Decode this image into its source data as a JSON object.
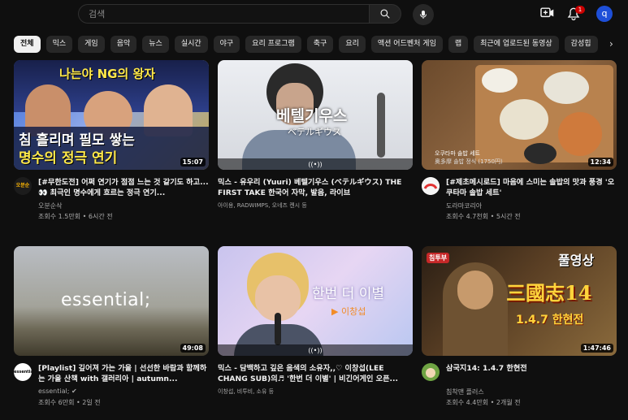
{
  "search": {
    "placeholder": "검색"
  },
  "header": {
    "notification_count": "1",
    "avatar_letter": "q"
  },
  "chips": [
    "전체",
    "믹스",
    "게임",
    "음악",
    "뉴스",
    "실시간",
    "야구",
    "요리 프로그램",
    "축구",
    "요리",
    "액션 어드벤처 게임",
    "랩",
    "최근에 업로드된 동영상",
    "감성힙"
  ],
  "videos": [
    {
      "title": "[#무한도전] 어쩌 연기가 점점 느는 것 같기도 하고...👀 최극인 명수에게 흐르는 정극 연기...",
      "channel": "오분순삭",
      "stats": "조회수 1.5만회 • 6시간 전",
      "duration": "15:07",
      "thumb_lines": [
        "나는야 NG의 왕자",
        "침 흘리며 필모 쌓는",
        "명수의 정극 연기"
      ],
      "channel_avatar_text": "오분순삭"
    },
    {
      "title": "믹스 - 유우리 (Yuuri) 베텔기우스 (ベテルギウス) THE FIRST TAKE 한국어 자막, 발음, 라이브",
      "channel": "아이용, RADWIMPS, 오네즈 켄시 등",
      "stats": "",
      "duration": "",
      "thumb_lines": [
        "베텔기우스",
        "ベテルギウス"
      ]
    },
    {
      "title": "[#제초메시로드] 마음에 스미는 솔밥의 맛과 풍경 '오쿠타마 솔밥 세트'",
      "channel": "도라마코리아",
      "stats": "조회수 4.7천회 • 5시간 전",
      "duration": "12:34",
      "thumb_lines": [
        "오쿠타마 솔밥 세트",
        "奥多摩 솔밥 정식 (1750円)"
      ]
    },
    {
      "title": "[Playlist] 깊어져 가는 가을 | 선선한 바람과 함께하는 가을 산책 with 갤러리아 | autumn...",
      "channel": "essential; ✔",
      "stats": "조회수 6만회 • 2일 전",
      "duration": "49:08",
      "thumb_lines": [
        "essential;"
      ]
    },
    {
      "title": "믹스 - 담백하고 깊은 음색의 소유자,,♡ 이창섭(LEE CHANG SUB)의♬ '한번 더 이별' | 비긴어게인 오픈...",
      "channel": "이창섭, 비투비, 소유 등",
      "stats": "",
      "duration": "",
      "thumb_lines": [
        "한번 더 이별",
        "▶ 이창섭"
      ]
    },
    {
      "title": "삼국지14: 1.4.7 한현전",
      "channel": "침착맨 플러스",
      "stats": "조회수 4.4만회 • 2개월 전",
      "duration": "1:47:46",
      "thumb_lines": [
        "풀영상",
        "三國志14",
        "1.4.7 한현전",
        "침투부"
      ]
    }
  ],
  "colors": {
    "accent": "#cc0000",
    "background": "#0f0f0f",
    "chip": "#272727",
    "avatar": "#1e4fd8"
  }
}
